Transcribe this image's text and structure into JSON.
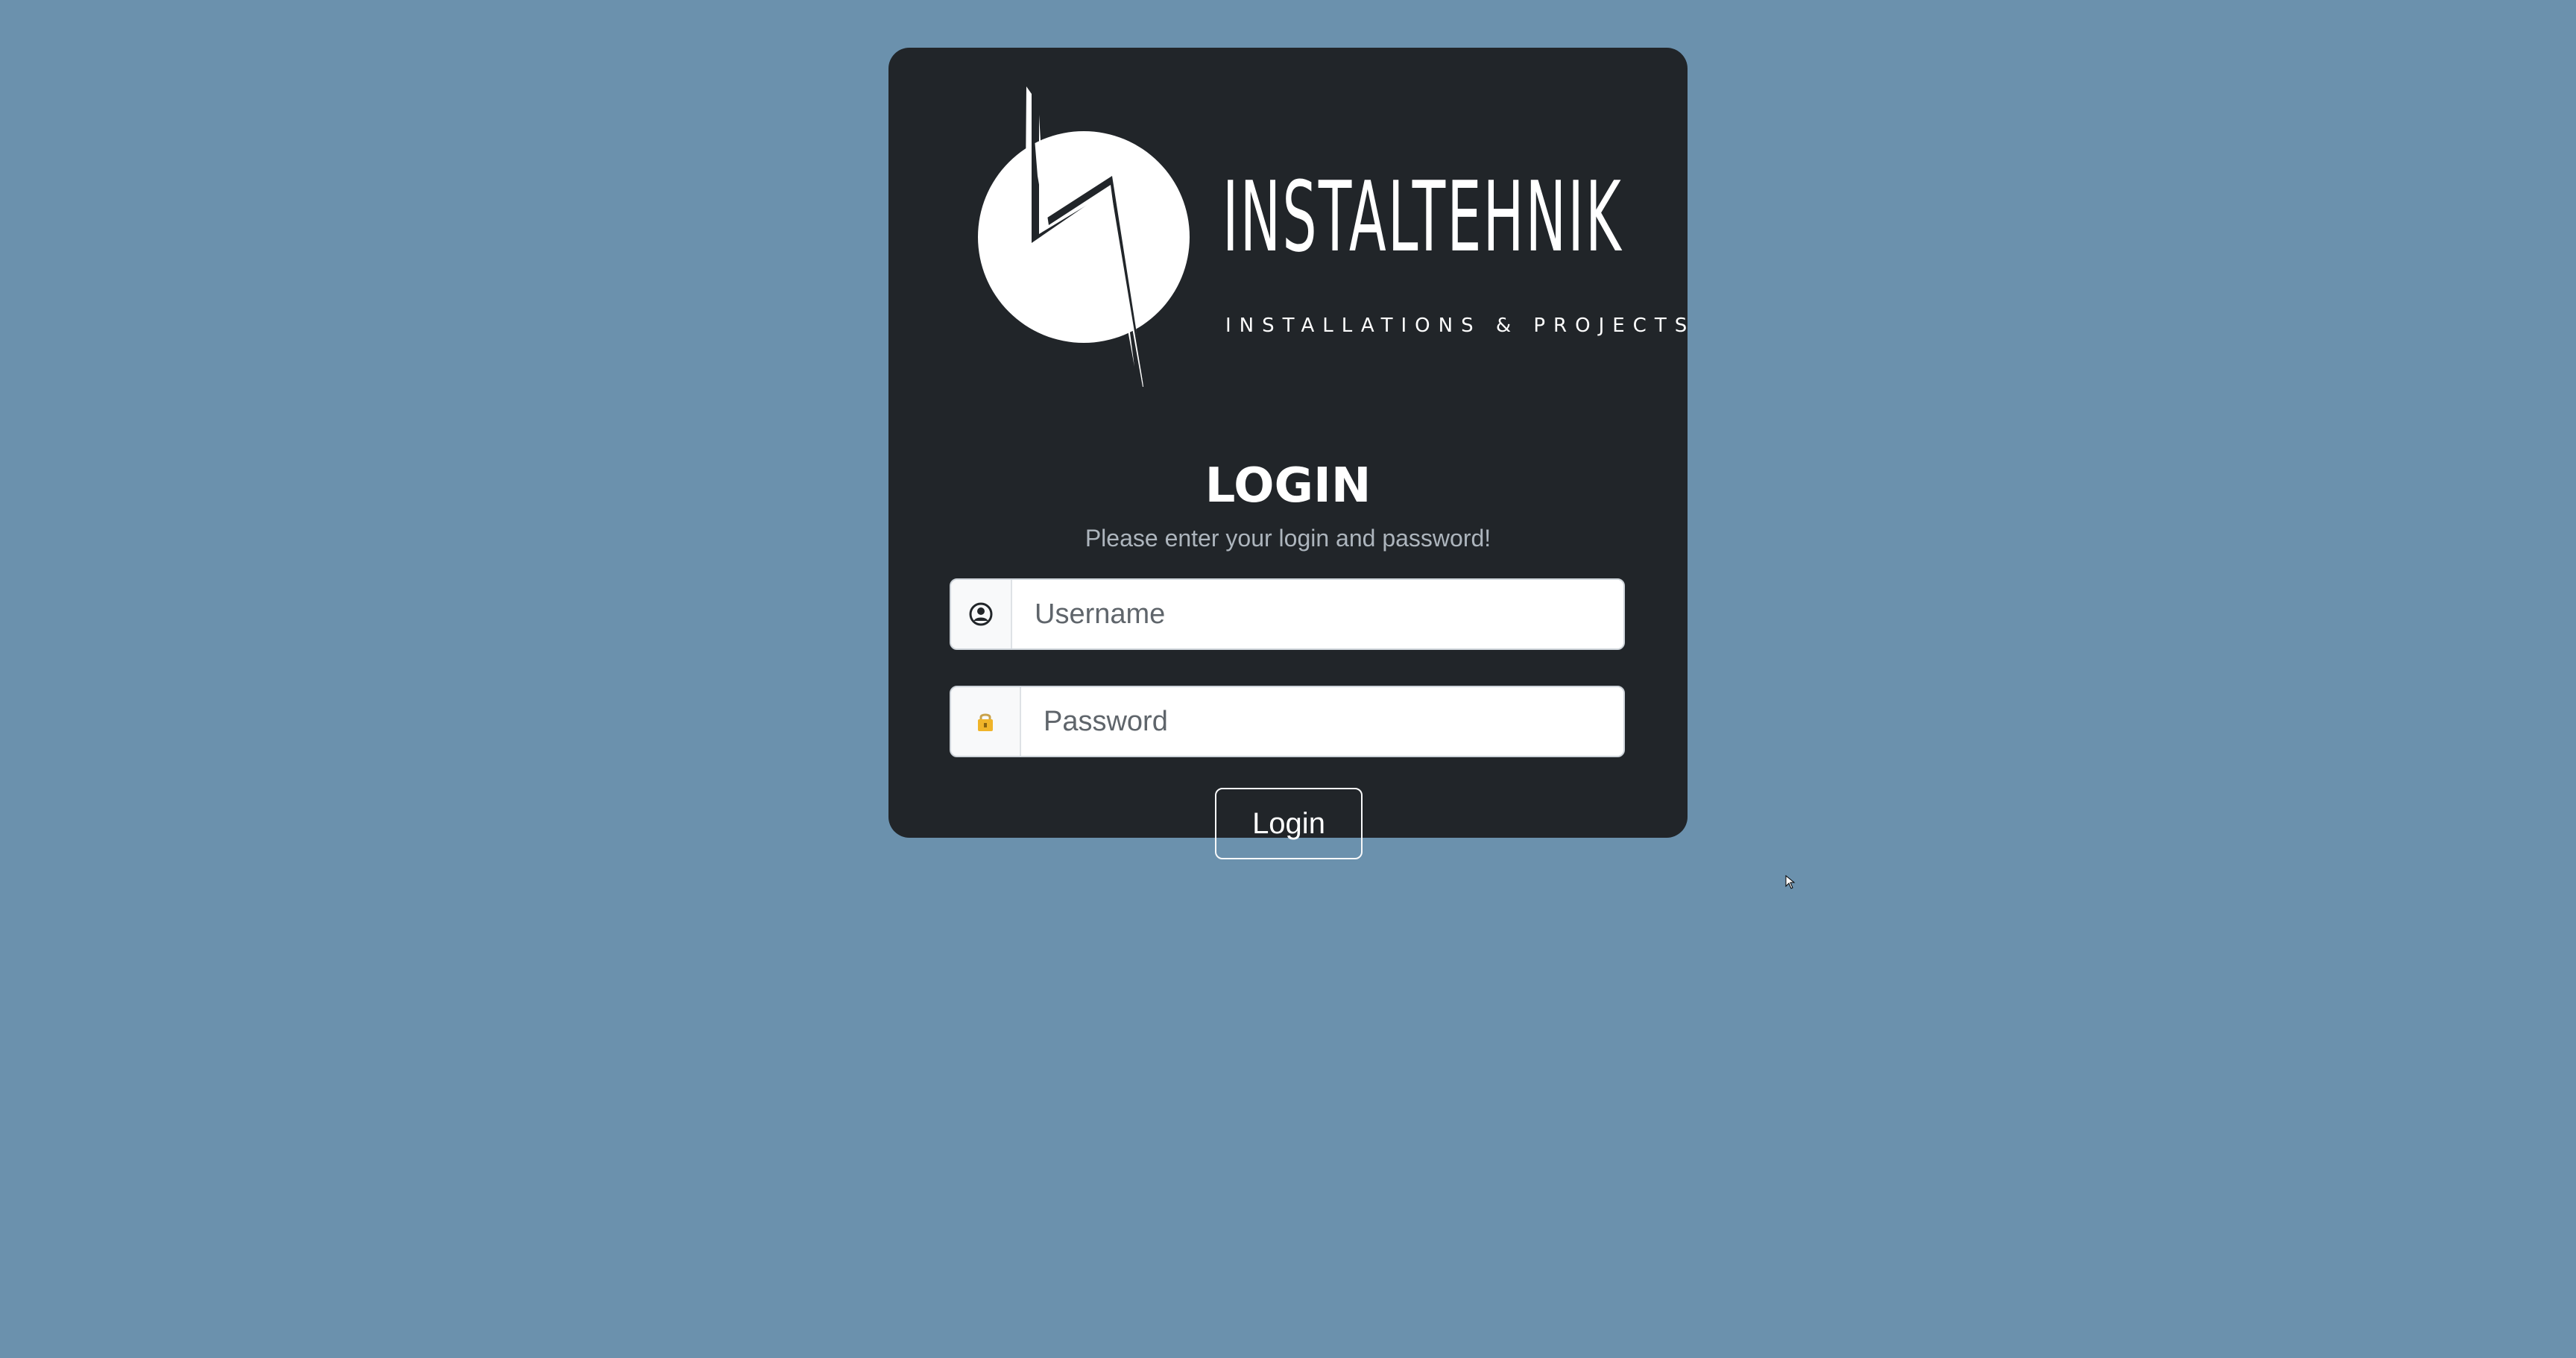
{
  "brand": {
    "name": "INSTALTEHNIK",
    "tagline": "INSTALLATIONS & PROJECTS",
    "logo_icon": "lightning-bolt-circle-logo"
  },
  "login": {
    "title": "LOGIN",
    "subtitle": "Please enter your login and password!",
    "username": {
      "icon": "user-circle-icon",
      "placeholder": "Username",
      "value": ""
    },
    "password": {
      "icon": "lock-icon",
      "placeholder": "Password",
      "value": ""
    },
    "submit_label": "Login"
  },
  "colors": {
    "background": "#6b91ad",
    "card": "#212529",
    "lock_icon": "#f0b429"
  }
}
